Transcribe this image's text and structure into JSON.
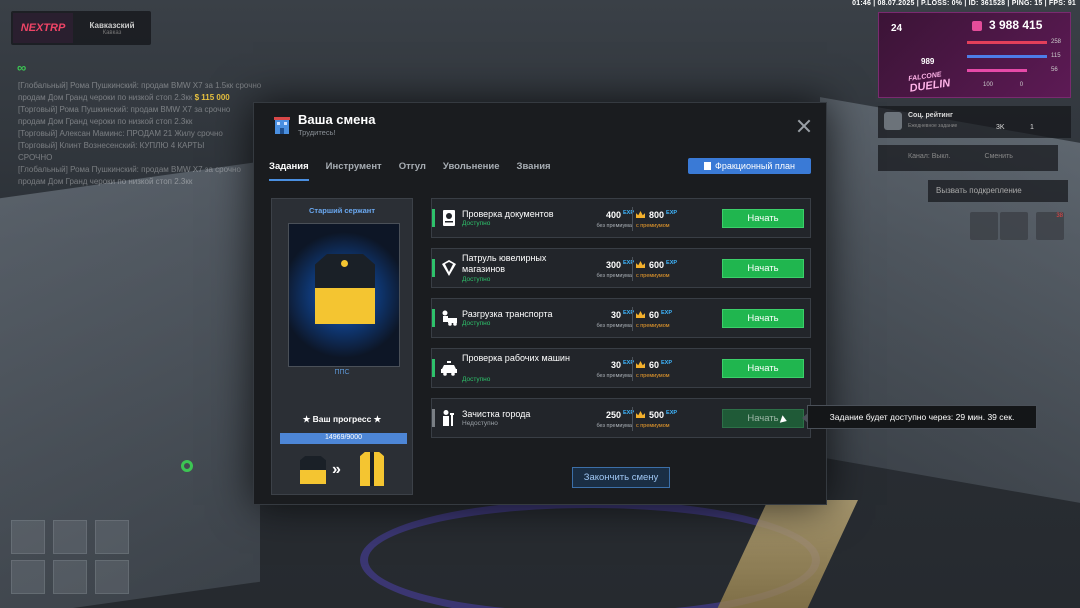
{
  "hud": {
    "top_stats": "01:46 | 08.07.2025 | P.LOSS: 0% | ID: 361528 | PING: 15 | FPS: 91",
    "logo_text": "NEXTRP",
    "server_name": "Кавказский",
    "server_sub": "Кавказ",
    "chat": [
      "[Глобальный] Рома Пушкинский: продам BMW X7 за 1.5кк срочно",
      "продам Дом Гранд чероки по низкой стоп 2.3кк",
      "[Торговый] Рома Пушкинский: продам BMW X7 за срочно",
      "продам Дом Гранд чероки по низкой стоп 2.3кк",
      "[Торговый] Алексан Маминс: ПРОДАМ 21 Жилу срочно",
      "[Торговый] Клинт Вознесенский: КУПЛЮ 4 КАРТЫ",
      "СРОЧНО",
      "[Глобальный] Рома Пушкинский: продам BMW X7 за срочно",
      "продам Дом Гранд чероки по низкой стоп 2.3кк"
    ],
    "chat_money": "$ 115 000",
    "profile": {
      "level": "24",
      "money": "3 988 415",
      "id": "989",
      "tag": "DUELIN",
      "clan": "FALCONE",
      "health": "258",
      "armor": "115",
      "hunger": "56",
      "thirst": "0",
      "extra": "100"
    },
    "soc": {
      "title": "Соц. рейтинг",
      "sub": "Ежедневное задание",
      "count_a": "3K",
      "count_b": "1"
    },
    "channel": {
      "label": "Канал: Выкл.",
      "action": "Сменить"
    },
    "backup": "Вызвать подкрепление",
    "badge_count": "38",
    "colors": {
      "accent": "#3a7ad6",
      "success": "#20b64f",
      "brand": "#5d1a55"
    }
  },
  "modal": {
    "title": "Ваша смена",
    "subtitle": "Трудитесь!",
    "tabs": [
      "Задания",
      "Инструмент",
      "Отгул",
      "Увольнение",
      "Звания"
    ],
    "faction_plan": "Фракционный план",
    "rank": {
      "title": "Старший сержант",
      "name": "ППС",
      "progress_label": "★ Ваш прогресс ★",
      "progress_text": "14969/9000",
      "progress_fraction": 1.0
    },
    "tasks": [
      {
        "name": "Проверка документов",
        "status": "Доступно",
        "exp": "400",
        "exp_premium": "800",
        "sub1": "без премиума",
        "sub2": "с премиумом",
        "button": "Начать",
        "icon": "document-icon",
        "locked": false
      },
      {
        "name": "Патруль ювелирных магазинов",
        "status": "Доступно",
        "exp": "300",
        "exp_premium": "600",
        "sub1": "без премиума",
        "sub2": "с премиумом",
        "button": "Начать",
        "icon": "jewel-icon",
        "locked": false
      },
      {
        "name": "Разгрузка транспорта",
        "status": "Доступно",
        "exp": "30",
        "exp_premium": "60",
        "sub1": "без премиума",
        "sub2": "с премиумом",
        "button": "Начать",
        "icon": "truck-icon",
        "locked": false
      },
      {
        "name": "Проверка рабочих машин",
        "status": "Доступно",
        "exp": "30",
        "exp_premium": "60",
        "sub1": "без премиума",
        "sub2": "с премиумом",
        "button": "Начать",
        "icon": "police-car-icon",
        "locked": false
      },
      {
        "name": "Зачистка города",
        "status": "Недоступно",
        "exp": "250",
        "exp_premium": "500",
        "sub1": "без премиума",
        "sub2": "с премиумом",
        "button": "Начать",
        "icon": "person-icon",
        "locked": true
      }
    ],
    "exp_badge": "EXP",
    "end_shift": "Закончить смену"
  },
  "tooltip": "Задание будет доступно через: 29 мин. 39 сек."
}
